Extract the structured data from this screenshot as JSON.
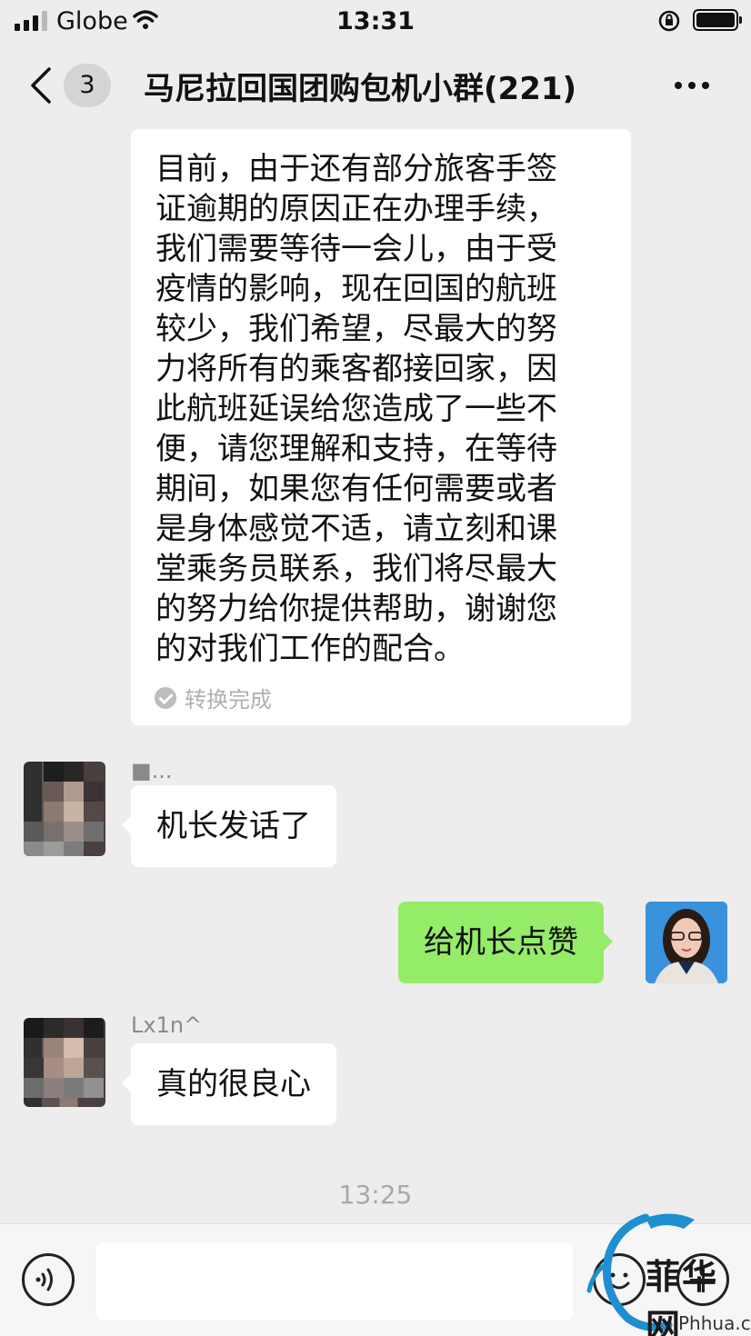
{
  "status_bar": {
    "carrier": "Globe",
    "time": "13:31"
  },
  "nav": {
    "back_badge": "3",
    "title": "马尼拉回国团购包机小群(221)"
  },
  "messages": {
    "long_text_lines": [
      "目前，由于还有部分旅客手签",
      "证逾期的原因正在办理手续，",
      "我们需要等待一会儿，由于受",
      "疫情的影响，现在回国的航班",
      "较少，我们希望，尽最大的努",
      "力将所有的乘客都接回家，因",
      "此航班延误给您造成了一些不",
      "便，请您理解和支持，在等待",
      "期间，如果您有任何需要或者",
      "是身体感觉不适，请立刻和课",
      "堂乘务员联系，我们将尽最大",
      "的努力给你提供帮助，谢谢您",
      "的对我们工作的配合。"
    ],
    "convert_status": "转换完成",
    "msg1_sender": "■...",
    "msg1_text": "机长发话了",
    "msg2_text": "给机长点赞",
    "msg3_sender": "Lx1n^",
    "msg3_text": "真的很良心",
    "timestamp": "13:25"
  },
  "watermark": {
    "text": "菲华网",
    "url": "Phhua.com"
  },
  "colors": {
    "background": "#ededed",
    "my_bubble": "#95ec69",
    "other_bubble": "#ffffff"
  }
}
